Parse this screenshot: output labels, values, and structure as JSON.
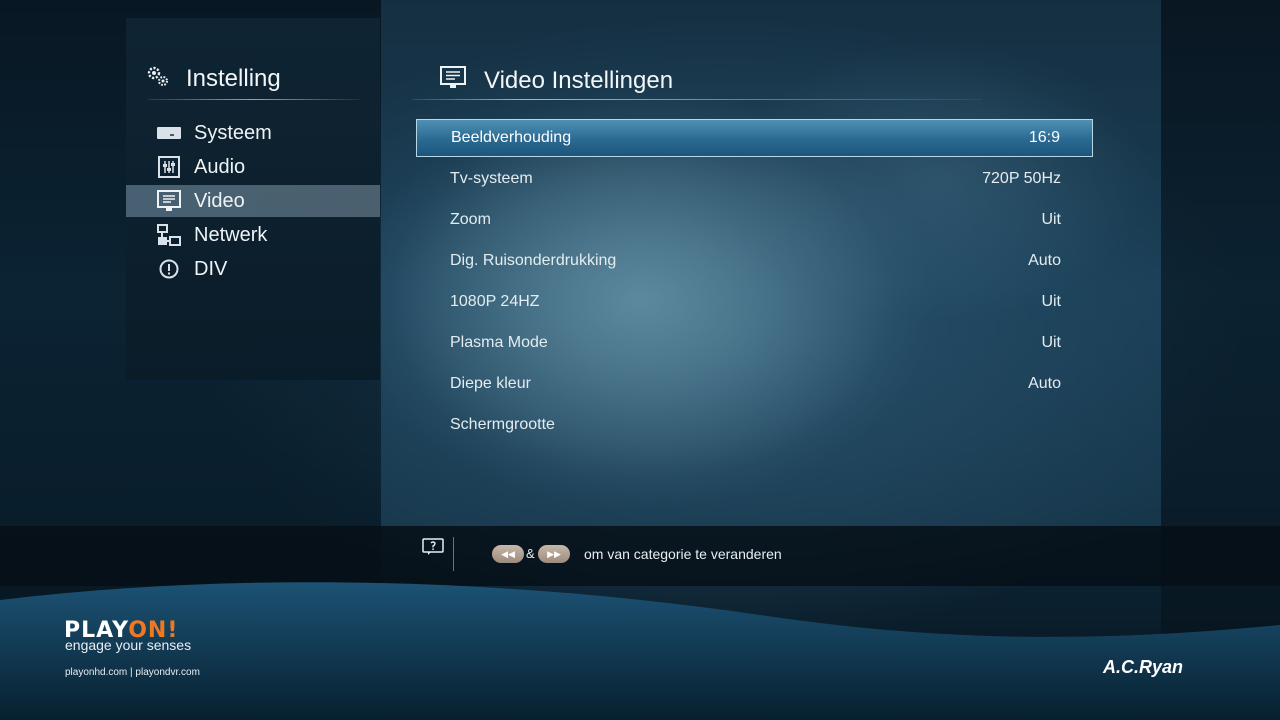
{
  "sidebar": {
    "title": "Instelling",
    "items": [
      {
        "label": "Systeem",
        "icon": "system-icon"
      },
      {
        "label": "Audio",
        "icon": "audio-icon"
      },
      {
        "label": "Video",
        "icon": "video-icon",
        "active": true
      },
      {
        "label": "Netwerk",
        "icon": "network-icon"
      },
      {
        "label": "DIV",
        "icon": "info-icon"
      }
    ]
  },
  "panel": {
    "title": "Video Instellingen",
    "rows": [
      {
        "label": "Beeldverhouding",
        "value": "16:9",
        "selected": true
      },
      {
        "label": "Tv-systeem",
        "value": "720P 50Hz"
      },
      {
        "label": "Zoom",
        "value": "Uit"
      },
      {
        "label": "Dig. Ruisonderdrukking",
        "value": "Auto"
      },
      {
        "label": "1080P 24HZ",
        "value": "Uit"
      },
      {
        "label": "Plasma Mode",
        "value": "Uit"
      },
      {
        "label": "Diepe kleur",
        "value": "Auto"
      },
      {
        "label": "Schermgrootte",
        "value": ""
      }
    ]
  },
  "help": {
    "amp": "&",
    "text": "om van categorie te veranderen"
  },
  "footer": {
    "logo_left": "PLAY",
    "logo_right": "ON!",
    "tagline": "engage your senses",
    "urls": "playonhd.com  |  playondvr.com",
    "brand": "A.C.Ryan"
  },
  "colors": {
    "selection": "#2a6a92",
    "logo_accent": "#f07820",
    "pill": "#b3a393"
  }
}
